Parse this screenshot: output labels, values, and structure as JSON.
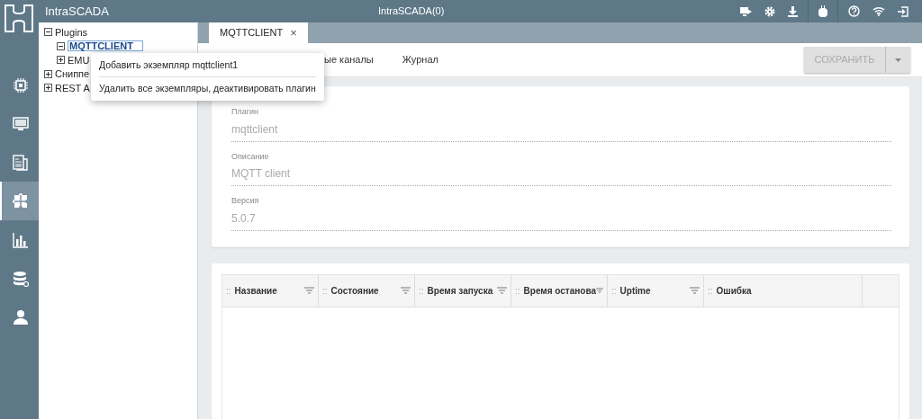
{
  "app": {
    "name": "IntraSCADA",
    "title": "IntraSCADA(0)"
  },
  "rail": [
    {
      "kind": "chip",
      "selected": false
    },
    {
      "kind": "monitor",
      "selected": false
    },
    {
      "kind": "document",
      "selected": false
    },
    {
      "kind": "puzzle",
      "selected": true
    },
    {
      "kind": "chart",
      "selected": false
    },
    {
      "kind": "database",
      "selected": false
    },
    {
      "kind": "user",
      "selected": false
    }
  ],
  "tree": [
    {
      "label": "Plugins",
      "expanded": true,
      "children": [
        {
          "label": "MQTTCLIENT",
          "expanded": true,
          "selected": true
        },
        {
          "label": "EMU",
          "expanded": false,
          "selected": false
        }
      ]
    },
    {
      "label": "Сниппе",
      "expanded": false
    },
    {
      "label": "REST A",
      "expanded": false
    }
  ],
  "context_menu": [
    "Добавить экземпляр mqttclient1",
    "Удалить все экземпляры, деактивировать плагин"
  ],
  "tabs": [
    {
      "label": "MQTTCLIENT",
      "close": "×",
      "selected": true
    }
  ],
  "subtabs": [
    {
      "label": "ые каналы",
      "selected": false
    },
    {
      "label": "Журнал",
      "selected": false
    }
  ],
  "save_button": {
    "label": "СОХРАНИТЬ",
    "disabled": true
  },
  "fields": [
    {
      "label": "Плагин",
      "value": "mqttclient"
    },
    {
      "label": "Описание",
      "value": "MQTT client"
    },
    {
      "label": "Версия",
      "value": "5.0.7"
    }
  ],
  "table": {
    "columns": [
      {
        "handle": "::",
        "label": "Название"
      },
      {
        "handle": "::",
        "label": "Состояние"
      },
      {
        "handle": "::",
        "label": "Время запуска"
      },
      {
        "handle": "::",
        "label": "Время останова"
      },
      {
        "handle": "::",
        "label": "Uptime"
      },
      {
        "handle": "::",
        "label": "Ошибка"
      }
    ]
  }
}
